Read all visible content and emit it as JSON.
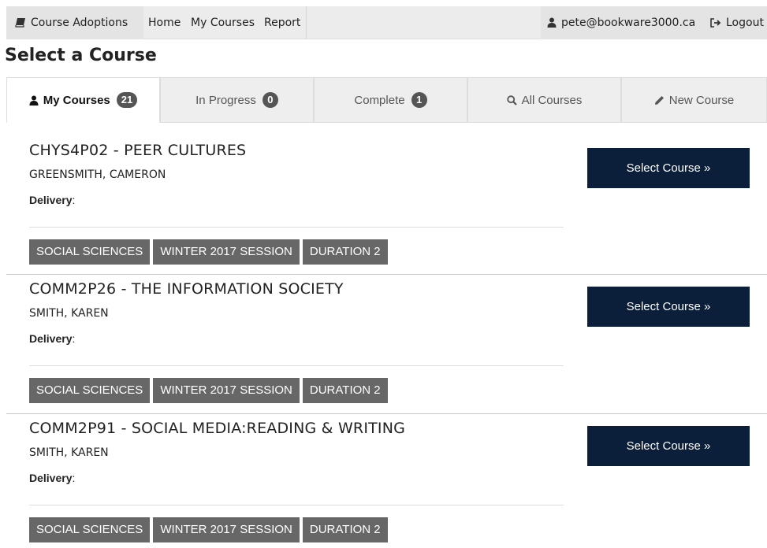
{
  "nav": {
    "brand_label": "Course Adoptions",
    "home_label": "Home",
    "mycourses_label": "My Courses",
    "report_label": "Report",
    "user_email": "pete@bookware3000.ca",
    "logout_label": "Logout"
  },
  "page": {
    "title": "Select a Course"
  },
  "tabs": [
    {
      "label": "My Courses",
      "count": "21",
      "icon": "user-icon",
      "active": true
    },
    {
      "label": "In Progress",
      "count": "0"
    },
    {
      "label": "Complete",
      "count": "1"
    },
    {
      "label": "All Courses",
      "icon": "search-icon"
    },
    {
      "label": "New Course",
      "icon": "pencil-icon"
    }
  ],
  "courses": [
    {
      "title": "CHYS4P02 - PEER CULTURES",
      "instructor": "GREENSMITH, CAMERON",
      "delivery_label": "Delivery",
      "delivery_value": "",
      "tags": [
        "SOCIAL SCIENCES",
        "WINTER 2017 SESSION",
        "DURATION 2"
      ],
      "select_label": "Select Course »"
    },
    {
      "title": "COMM2P26 - THE INFORMATION SOCIETY",
      "instructor": "SMITH, KAREN",
      "delivery_label": "Delivery",
      "delivery_value": "",
      "tags": [
        "SOCIAL SCIENCES",
        "WINTER 2017 SESSION",
        "DURATION 2"
      ],
      "select_label": "Select Course »"
    },
    {
      "title": "COMM2P91 - SOCIAL MEDIA:READING & WRITING",
      "instructor": "SMITH, KAREN",
      "delivery_label": "Delivery",
      "delivery_value": "",
      "tags": [
        "SOCIAL SCIENCES",
        "WINTER 2017 SESSION",
        "DURATION 2"
      ],
      "select_label": "Select Course »"
    }
  ],
  "colors": {
    "nav_bg": "#ececec",
    "select_button_bg": "#0b1f3a",
    "tag_bg": "#676767",
    "badge_bg": "#555555"
  }
}
